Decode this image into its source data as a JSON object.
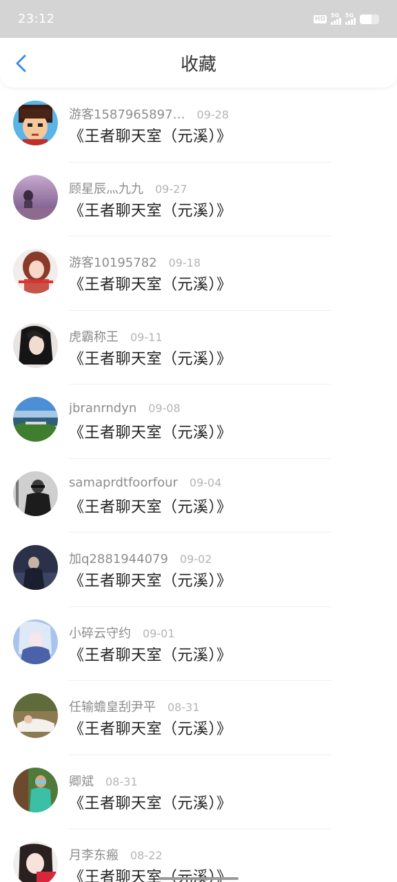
{
  "status_bar": {
    "time": "23:12",
    "hd": "HD",
    "net1": "5G",
    "net2": "5G"
  },
  "header": {
    "title": "收藏",
    "back_icon": "chevron-left-icon",
    "accent": "#3a8ee6"
  },
  "favorites": [
    {
      "user": "游客1587965897…",
      "date": "09-28",
      "room": "《王者聊天室（元溪）》",
      "avatar": "avatar-cartoon-boy"
    },
    {
      "user": "顾星辰灬九九",
      "date": "09-27",
      "room": "《王者聊天室（元溪）》",
      "avatar": "avatar-purple-girl"
    },
    {
      "user": "游客10195782",
      "date": "09-18",
      "room": "《王者聊天室（元溪）》",
      "avatar": "avatar-red-hair-girl"
    },
    {
      "user": "虎霸称王",
      "date": "09-11",
      "room": "《王者聊天室（元溪）》",
      "avatar": "avatar-anime-dark"
    },
    {
      "user": "jbranrndyn",
      "date": "09-08",
      "room": "《王者聊天室（元溪）》",
      "avatar": "avatar-landscape"
    },
    {
      "user": "samaprdtfoorfour",
      "date": "09-04",
      "room": "《王者聊天室（元溪）》",
      "avatar": "avatar-bw-man"
    },
    {
      "user": "加q2881944079",
      "date": "09-02",
      "room": "《王者聊天室（元溪）》",
      "avatar": "avatar-night-figure"
    },
    {
      "user": "小碎云守约",
      "date": "09-01",
      "room": "《王者聊天室（元溪）》",
      "avatar": "avatar-blue-anime"
    },
    {
      "user": "任输蟾皇刮尹平",
      "date": "08-31",
      "room": "《王者聊天室（元溪）》",
      "avatar": "avatar-lying-girl"
    },
    {
      "user": "卿斌",
      "date": "08-31",
      "room": "《王者聊天室（元溪）》",
      "avatar": "avatar-boy-outdoor"
    },
    {
      "user": "月李东瘢",
      "date": "08-22",
      "room": "《王者聊天室（元溪）》",
      "avatar": "avatar-girl-red-text"
    }
  ]
}
